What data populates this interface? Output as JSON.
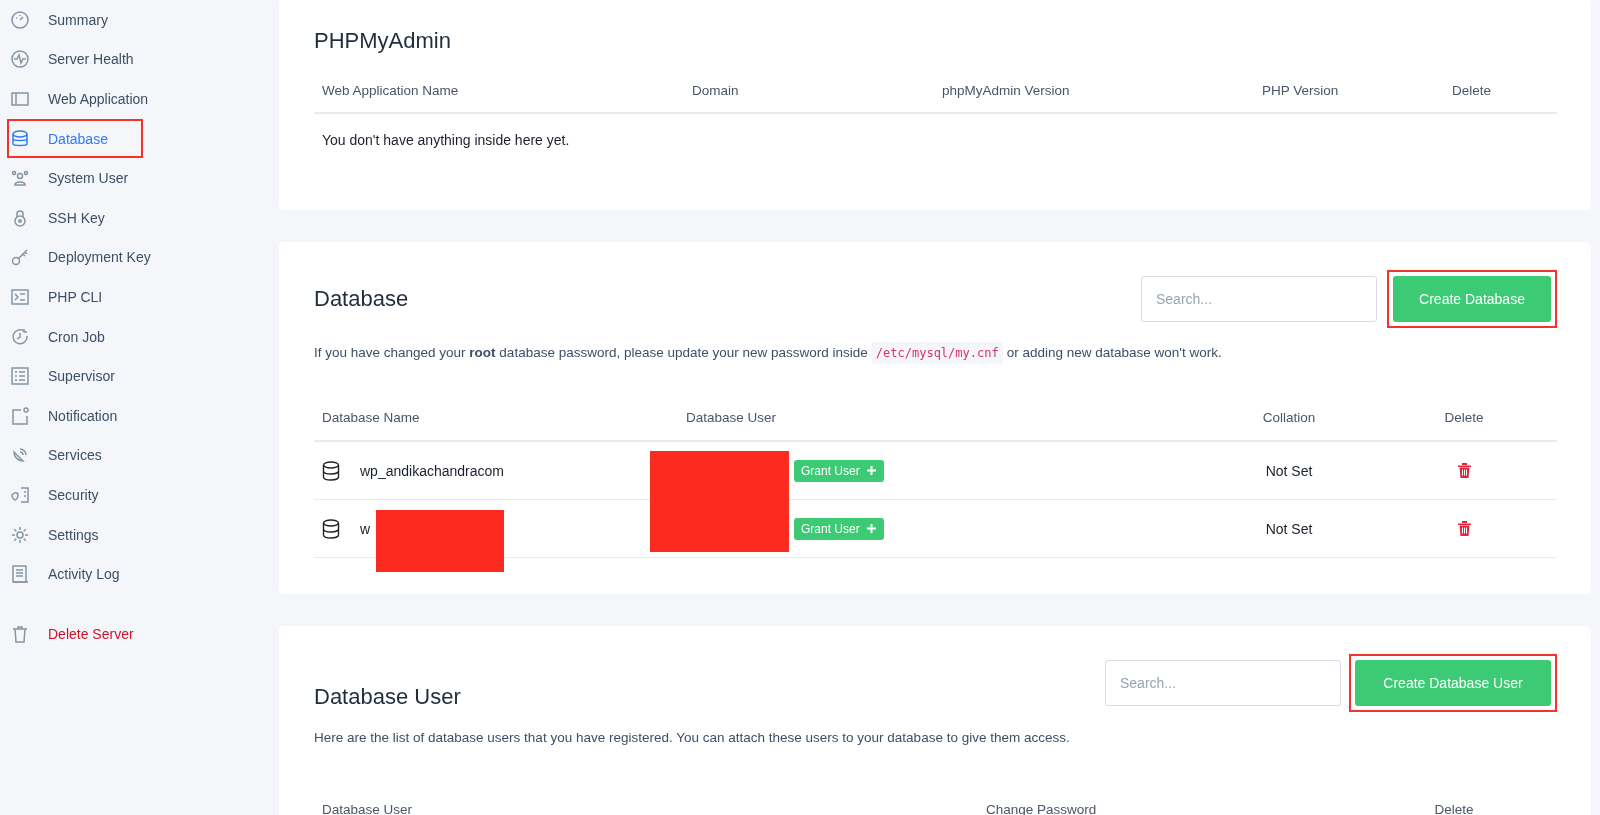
{
  "sidebar": {
    "items": [
      {
        "label": "Summary",
        "selected": false,
        "highlighted": false,
        "kind": "nav"
      },
      {
        "label": "Server Health",
        "selected": false,
        "highlighted": false,
        "kind": "nav"
      },
      {
        "label": "Web Application",
        "selected": false,
        "highlighted": false,
        "kind": "nav"
      },
      {
        "label": "Database",
        "selected": true,
        "highlighted": true,
        "kind": "nav"
      },
      {
        "label": "System User",
        "selected": false,
        "highlighted": false,
        "kind": "nav"
      },
      {
        "label": "SSH Key",
        "selected": false,
        "highlighted": false,
        "kind": "nav"
      },
      {
        "label": "Deployment Key",
        "selected": false,
        "highlighted": false,
        "kind": "nav"
      },
      {
        "label": "PHP CLI",
        "selected": false,
        "highlighted": false,
        "kind": "nav"
      },
      {
        "label": "Cron Job",
        "selected": false,
        "highlighted": false,
        "kind": "nav"
      },
      {
        "label": "Supervisor",
        "selected": false,
        "highlighted": false,
        "kind": "nav"
      },
      {
        "label": "Notification",
        "selected": false,
        "highlighted": false,
        "kind": "nav"
      },
      {
        "label": "Services",
        "selected": false,
        "highlighted": false,
        "kind": "nav"
      },
      {
        "label": "Security",
        "selected": false,
        "highlighted": false,
        "kind": "nav"
      },
      {
        "label": "Settings",
        "selected": false,
        "highlighted": false,
        "kind": "nav"
      },
      {
        "label": "Activity Log",
        "selected": false,
        "highlighted": false,
        "kind": "nav"
      },
      {
        "label": "Delete Server",
        "selected": false,
        "highlighted": false,
        "kind": "danger"
      }
    ]
  },
  "phpmyadmin": {
    "title": "PHPMyAdmin",
    "columns": [
      "Web Application Name",
      "Domain",
      "phpMyAdmin Version",
      "PHP Version",
      "Delete"
    ],
    "empty_message": "You don't have anything inside here yet."
  },
  "database": {
    "title": "Database",
    "search": {
      "placeholder": "Search..."
    },
    "create_button": {
      "label": "Create Database",
      "highlighted": true
    },
    "notice": "If you have changed your **root** database password, please update your new password inside",
    "notice_path": "/etc/mysql/my.cnf",
    "notice_end": "or adding new database won't work.",
    "columns": [
      "Database Name",
      "Database User",
      "Collation",
      "Delete"
    ],
    "user_redacted": true,
    "rows": [
      {
        "name": "wp_andikachandracom",
        "name_redacted": false,
        "grant_label": "Grant User",
        "collation": "Not Set"
      },
      {
        "name": "w",
        "name_redacted": true,
        "grant_label": "Grant User",
        "collation": "Not Set"
      }
    ]
  },
  "database_user": {
    "title": "Database User",
    "search": {
      "placeholder": "Search..."
    },
    "create_button": {
      "label": "Create Database User",
      "highlighted": true
    },
    "description": "Here are the list of database users that you have registered. You can attach these users to your database to give them access.",
    "columns": [
      "Database User",
      "Change Password",
      "Delete"
    ]
  }
}
